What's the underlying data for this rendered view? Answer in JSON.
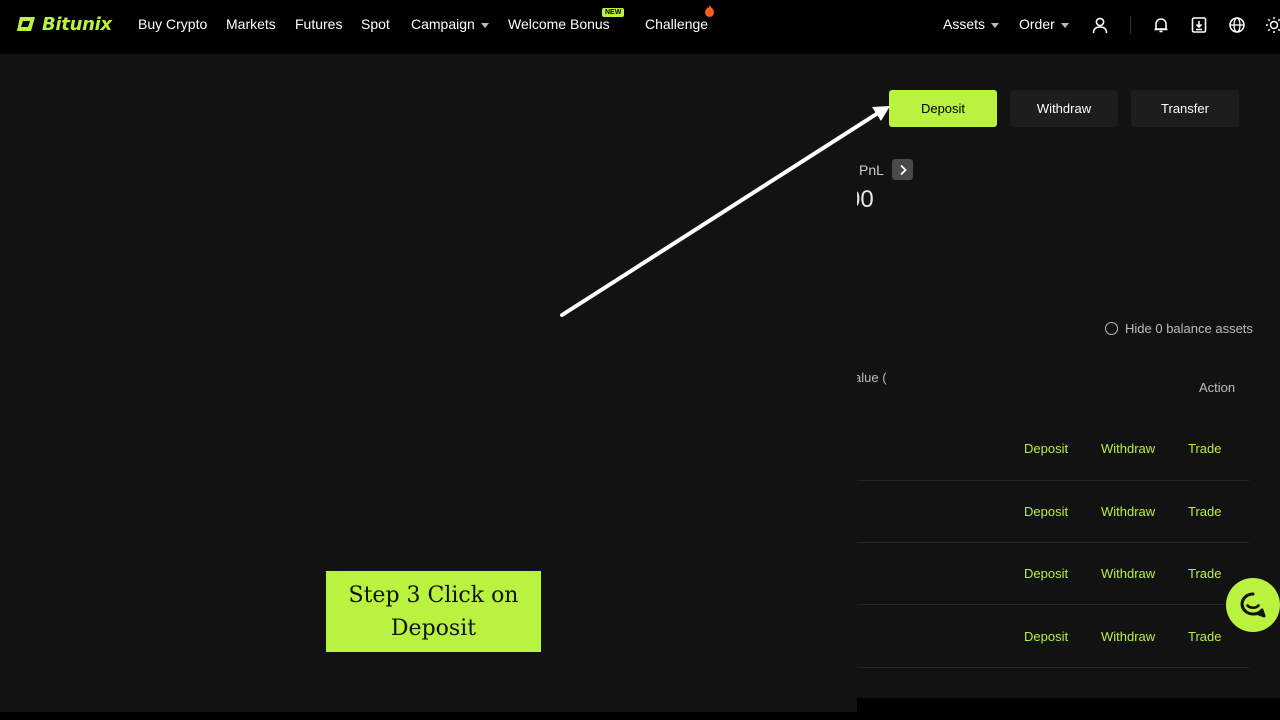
{
  "brand": {
    "name": "Bitunix",
    "accent": "#b9f23f"
  },
  "nav": {
    "items": [
      {
        "label": "Buy Crypto"
      },
      {
        "label": "Markets"
      },
      {
        "label": "Futures"
      },
      {
        "label": "Spot"
      },
      {
        "label": "Campaign"
      },
      {
        "label": "Welcome Bonus",
        "badge": "NEW"
      },
      {
        "label": "Challenge"
      }
    ],
    "right": {
      "assets": "Assets",
      "order": "Order"
    }
  },
  "actions": {
    "deposit": "Deposit",
    "withdraw": "Withdraw",
    "transfer": "Transfer"
  },
  "pnl": {
    "label": "PnL",
    "value": "00"
  },
  "filters": {
    "hide_zero": "Hide 0 balance assets"
  },
  "table": {
    "col_value": "alue (",
    "col_action": "Action",
    "rows": [
      {
        "deposit": "Deposit",
        "withdraw": "Withdraw",
        "trade": "Trade"
      },
      {
        "deposit": "Deposit",
        "withdraw": "Withdraw",
        "trade": "Trade"
      },
      {
        "deposit": "Deposit",
        "withdraw": "Withdraw",
        "trade": "Trade"
      },
      {
        "deposit": "Deposit",
        "withdraw": "Withdraw",
        "trade": "Trade"
      }
    ]
  },
  "annotation": {
    "step_line1": "Step 3 Click on",
    "step_line2": "Deposit"
  },
  "icons": [
    "user-icon",
    "bell-icon",
    "download-icon",
    "globe-icon",
    "sun-icon",
    "chat-icon"
  ]
}
